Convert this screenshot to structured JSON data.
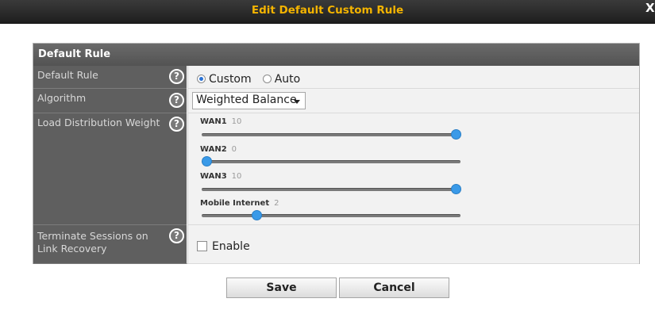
{
  "dialog": {
    "title": "Edit Default Custom Rule",
    "close_label": "X"
  },
  "panel": {
    "header": "Default Rule"
  },
  "rows": {
    "default_rule": {
      "label": "Default Rule",
      "options": [
        {
          "label": "Custom",
          "checked": true
        },
        {
          "label": "Auto",
          "checked": false
        }
      ]
    },
    "algorithm": {
      "label": "Algorithm",
      "selected": "Weighted Balance"
    },
    "load_distribution": {
      "label": "Load Distribution Weight",
      "wans": [
        {
          "name": "WAN1",
          "value": "10"
        },
        {
          "name": "WAN2",
          "value": "0"
        },
        {
          "name": "WAN3",
          "value": "10"
        },
        {
          "name": "Mobile Internet",
          "value": "2"
        }
      ],
      "max": 10
    },
    "terminate": {
      "label": "Terminate Sessions on Link Recovery",
      "checkbox_label": "Enable",
      "checked": false
    }
  },
  "help_icon": "?",
  "buttons": {
    "save": "Save",
    "cancel": "Cancel"
  },
  "colors": {
    "title": "#f4b400",
    "slider_handle": "#3a9ae8",
    "label_bg": "#5f5f5f"
  }
}
